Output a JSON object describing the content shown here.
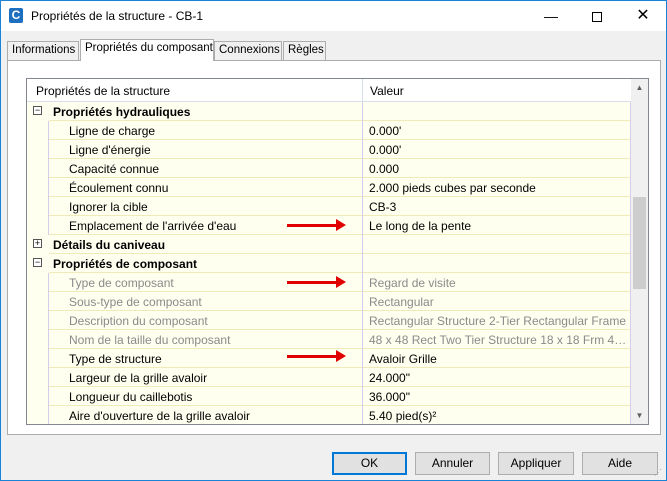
{
  "window": {
    "title": "Propriétés de la structure - CB-1",
    "app_icon_letter": "C",
    "minimize_glyph": "—",
    "close_glyph": "✕"
  },
  "tabs": [
    {
      "label": "Informations"
    },
    {
      "label": "Propriétés du composant"
    },
    {
      "label": "Connexions"
    },
    {
      "label": "Règles"
    }
  ],
  "grid": {
    "col_property": "Propriétés de la structure",
    "col_value": "Valeur",
    "rows": [
      {
        "type": "category",
        "expander": "−",
        "label": "Propriétés hydrauliques"
      },
      {
        "type": "item",
        "label": "Ligne de charge",
        "value": "0.000'"
      },
      {
        "type": "item",
        "label": "Ligne d'énergie",
        "value": "0.000'"
      },
      {
        "type": "item",
        "label": "Capacité connue",
        "value": "0.000"
      },
      {
        "type": "item",
        "label": "Écoulement connu",
        "value": "2.000 pieds cubes par seconde"
      },
      {
        "type": "item",
        "label": "Ignorer la cible",
        "value": "CB-3"
      },
      {
        "type": "item",
        "label": "Emplacement de l'arrivée d'eau",
        "value": "Le long de la pente"
      },
      {
        "type": "category",
        "expander": "+",
        "label": "Détails du caniveau"
      },
      {
        "type": "category",
        "expander": "−",
        "label": "Propriétés de composant"
      },
      {
        "type": "disabled",
        "label": "Type de composant",
        "value": "Regard de visite"
      },
      {
        "type": "disabled",
        "label": "Sous-type de composant",
        "value": "Rectangular"
      },
      {
        "type": "disabled",
        "label": "Description du composant",
        "value": "Rectangular Structure 2-Tier Rectangular Frame"
      },
      {
        "type": "disabled",
        "label": "Nom de la taille du composant",
        "value": "48 x 48 Rect Two Tier Structure 18 x 18 Frm 4 F..."
      },
      {
        "type": "item",
        "label": "Type de structure",
        "value": "Avaloir Grille"
      },
      {
        "type": "item",
        "label": "Largeur de la grille avaloir",
        "value": "24.000\""
      },
      {
        "type": "item",
        "label": "Longueur du caillebotis",
        "value": "36.000\""
      },
      {
        "type": "item",
        "label": "Aire d'ouverture de la grille avaloir",
        "value": "5.40 pied(s)²"
      }
    ]
  },
  "buttons": {
    "ok": "OK",
    "cancel": "Annuler",
    "apply": "Appliquer",
    "help": "Aide"
  },
  "colors": {
    "annotation_arrow": "#e00000",
    "row_background": "#fffff0",
    "accent": "#0078d7"
  }
}
